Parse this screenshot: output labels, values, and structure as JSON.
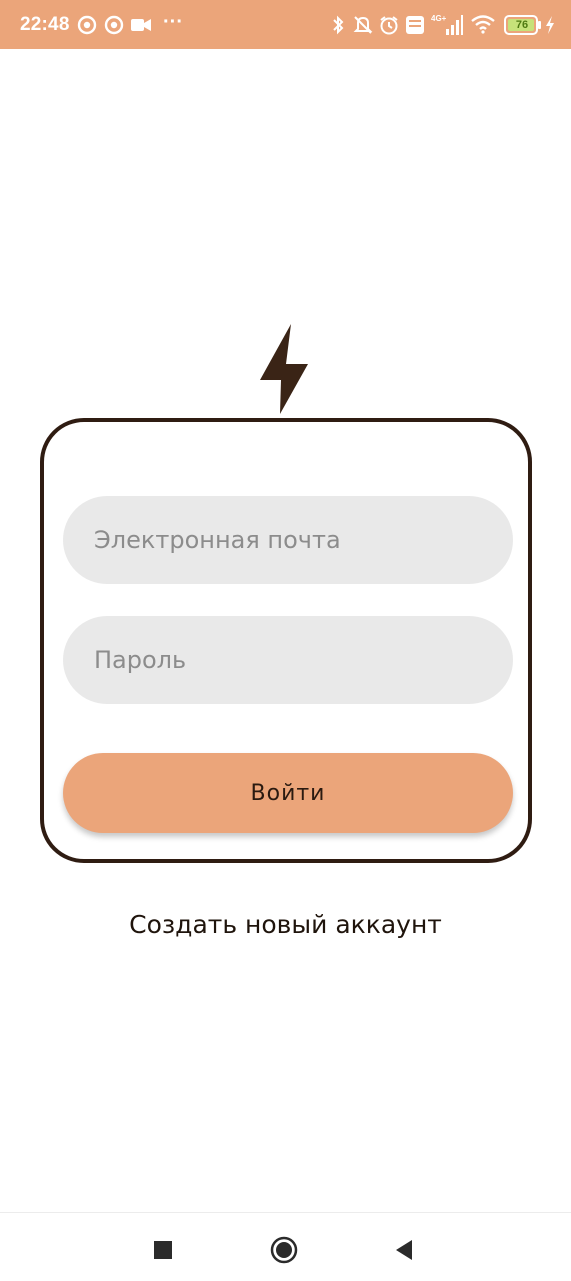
{
  "status_bar": {
    "time": "22:48",
    "overflow": "···",
    "battery_level": "76",
    "icons": [
      "notification-app-icon",
      "notification-app-icon",
      "video-camera-icon",
      "bluetooth-icon",
      "bell-muted-icon",
      "alarm-clock-icon",
      "volte-icon",
      "signal-4g-icon",
      "wifi-icon",
      "battery-icon",
      "charging-icon"
    ],
    "background_color": "#eba57a"
  },
  "logo": {
    "icon": "lightning-bolt-icon",
    "color": "#3a2416"
  },
  "login_form": {
    "email_placeholder": "Электронная почта",
    "password_placeholder": "Пароль",
    "submit_label": "Войти",
    "accent_color": "#eba57a",
    "border_color": "#2f1c12"
  },
  "create_account_label": "Создать новый аккаунт",
  "nav_bar": {
    "icons": [
      "recents-square-icon",
      "home-circle-icon",
      "back-triangle-icon"
    ]
  }
}
